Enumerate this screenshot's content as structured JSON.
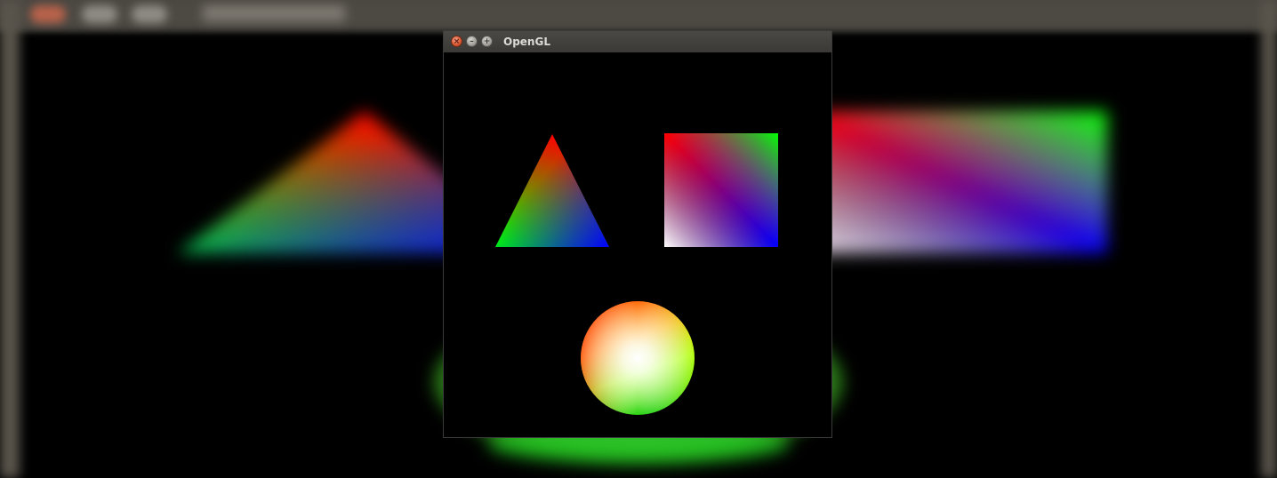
{
  "window": {
    "title": "OpenGL",
    "close_glyph": "×",
    "minimize_glyph": "–",
    "maximize_glyph": "+"
  },
  "icons": {
    "close": "close-icon",
    "minimize": "minimize-icon",
    "maximize": "maximize-icon"
  },
  "colors": {
    "red": "#ff0000",
    "green": "#00ff00",
    "blue": "#0000ff",
    "white": "#ffffff",
    "orange": "#ff8000",
    "yellow": "#ffff00",
    "background": "#000000",
    "titlebar": "#3c3b37",
    "title_text": "#dcdad5"
  },
  "scene": {
    "shapes": [
      "triangle",
      "square",
      "circle"
    ],
    "triangle_vertex_colors": [
      "#ff0000",
      "#00ff00",
      "#0000ff"
    ],
    "square_corner_colors": [
      "#ff0000",
      "#00ff00",
      "#0000ff",
      "#ffffff"
    ],
    "circle_center_color": "#ffffff"
  }
}
